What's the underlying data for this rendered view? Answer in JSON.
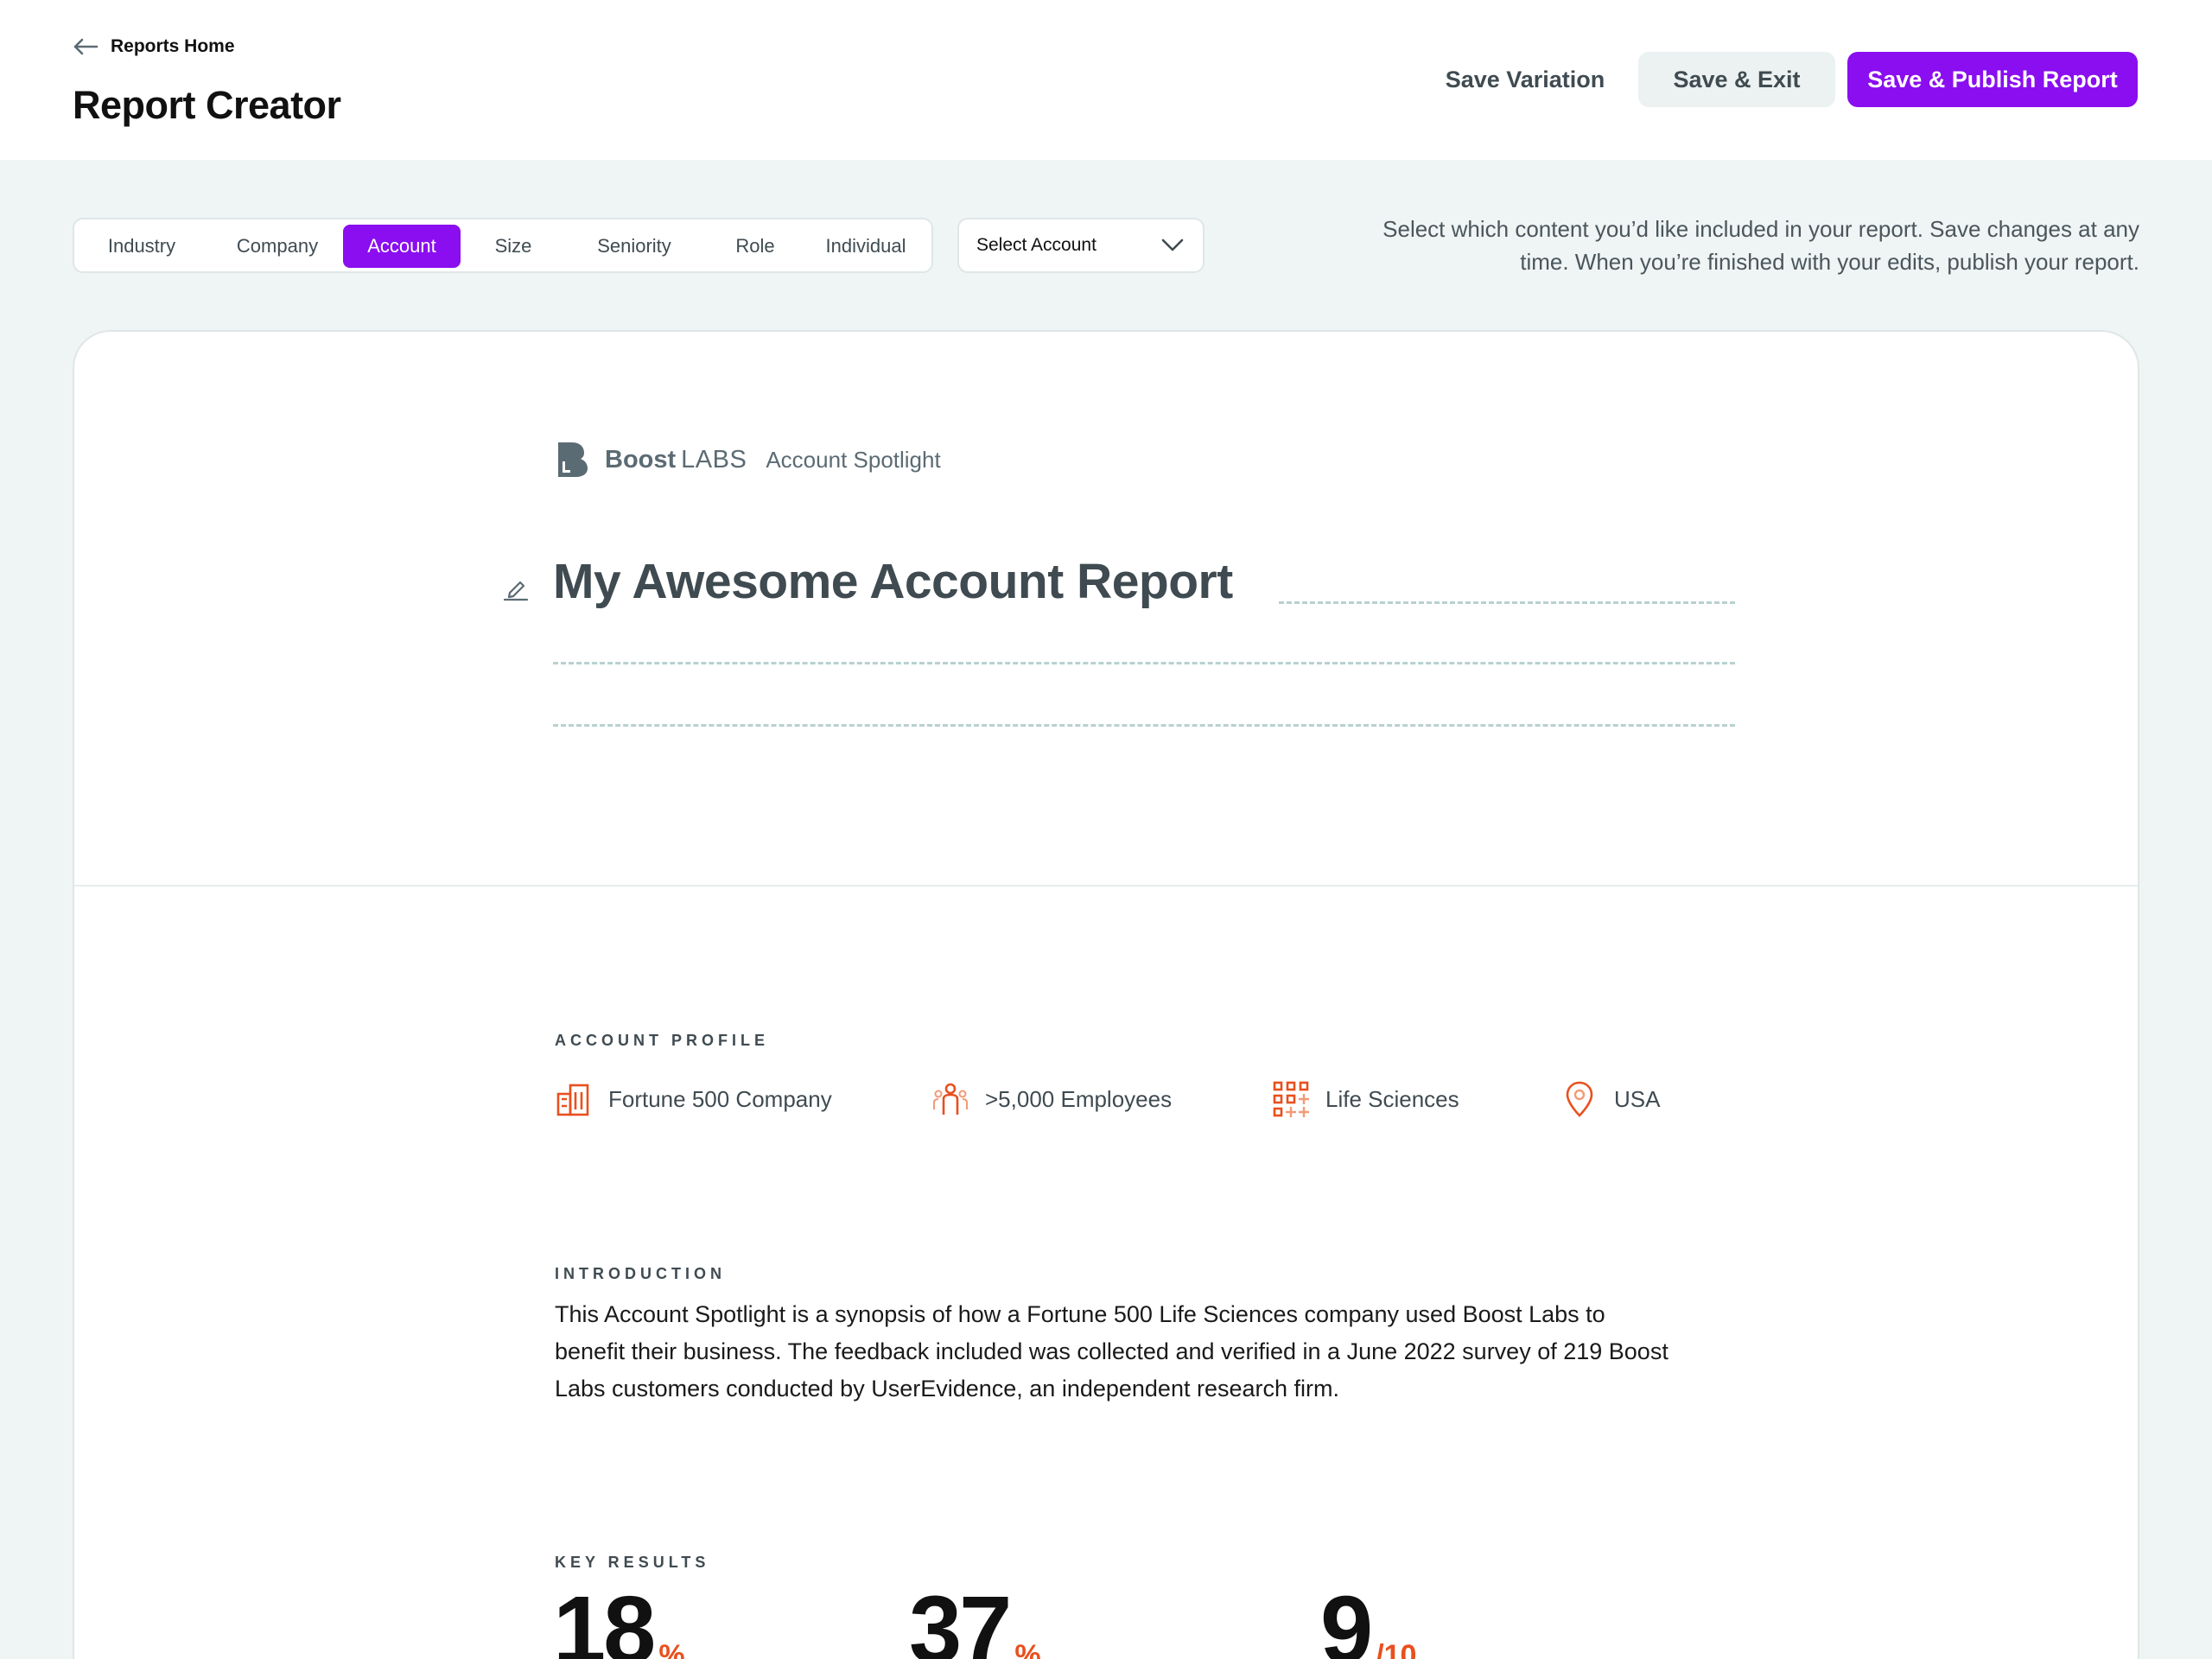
{
  "header": {
    "back_label": "Reports Home",
    "title": "Report Creator",
    "save_variation": "Save Variation",
    "save_exit": "Save & Exit",
    "save_publish": "Save & Publish Report"
  },
  "tabs": [
    {
      "label": "Industry"
    },
    {
      "label": "Company"
    },
    {
      "label": "Account",
      "active": true
    },
    {
      "label": "Size"
    },
    {
      "label": "Seniority"
    },
    {
      "label": "Role"
    },
    {
      "label": "Individual"
    }
  ],
  "account_select": {
    "label": "Select Account"
  },
  "help_text": "Select which content you’d like included in your report. Save changes at any time. When you’re finished with your edits, publish your report.",
  "report": {
    "brand_bold": "Boost",
    "brand_light": "LABS",
    "brand_subtitle": "Account Spotlight",
    "title": "My Awesome Account Report",
    "profile_heading": "ACCOUNT PROFILE",
    "profile": [
      {
        "icon": "building-icon",
        "label": "Fortune 500 Company"
      },
      {
        "icon": "people-icon",
        "label": ">5,000 Employees"
      },
      {
        "icon": "grid-icon",
        "label": "Life Sciences"
      },
      {
        "icon": "location-pin-icon",
        "label": "USA"
      }
    ],
    "intro_heading": "INTRODUCTION",
    "intro_text": "This Account Spotlight is a synopsis of how a Fortune 500 Life Sciences company used Boost Labs to benefit their business. The feedback included was collected and verified in a June 2022 survey of 219 Boost Labs customers conducted by UserEvidence, an independent research firm.",
    "results_heading": "KEY RESULTS",
    "results": [
      {
        "value": "18",
        "unit": "%"
      },
      {
        "value": "37",
        "unit": "%"
      },
      {
        "value": "9",
        "unit": "/10"
      }
    ]
  },
  "colors": {
    "accent": "#8a0ef0",
    "icon_orange": "#e8501e",
    "page_bg": "#eff4f4"
  }
}
